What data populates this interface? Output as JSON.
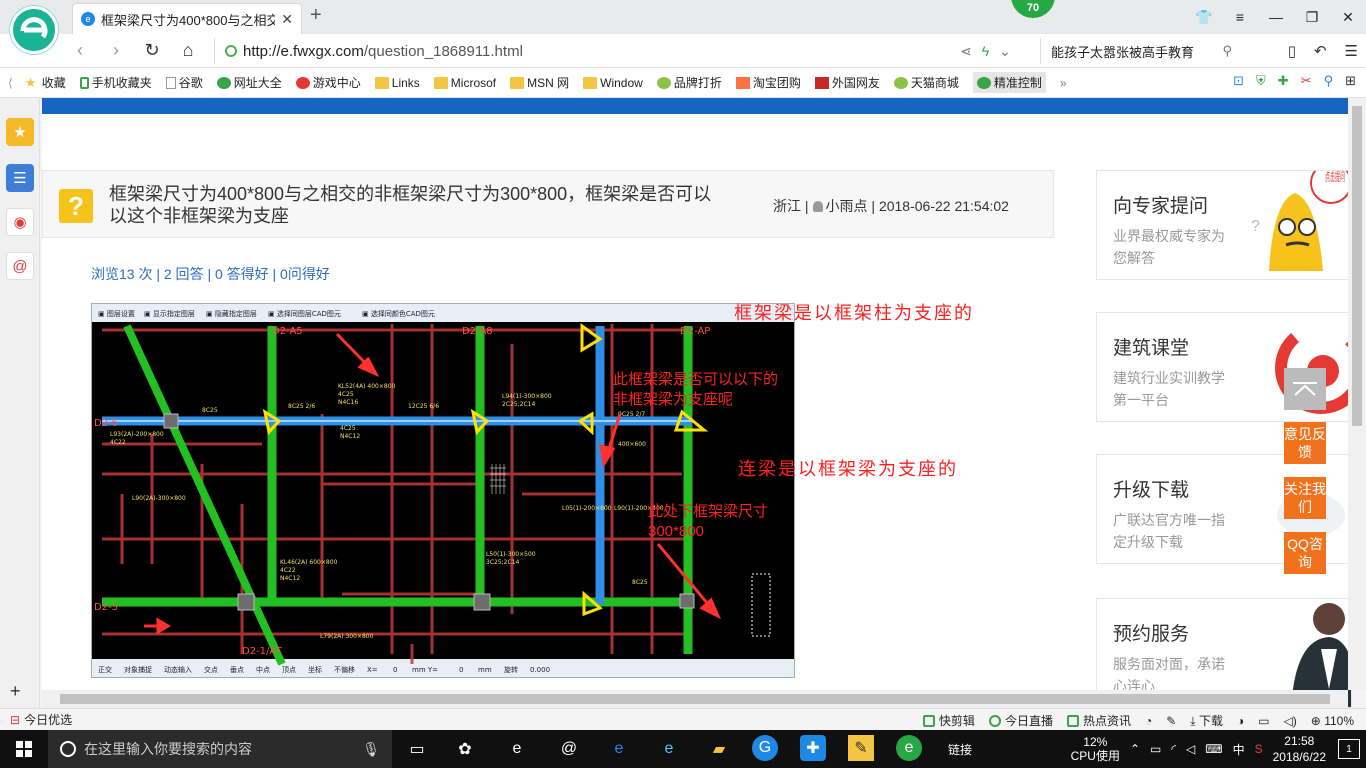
{
  "browser": {
    "tab_title": "框架梁尺寸为400*800与之相交的",
    "tab_badge": "70",
    "url_domain": "http://e.fwxgx.com",
    "url_path": "/question_1868911.html",
    "search_text": "能孩子太嚣张被高手教育"
  },
  "bookmarks": [
    "收藏",
    "手机收藏夹",
    "谷歌",
    "网址大全",
    "游戏中心",
    "Links",
    "Microsof",
    "MSN 网",
    "Window",
    "品牌打折",
    "淘宝团购",
    "外国网友",
    "天猫商城",
    "精准控制"
  ],
  "question": {
    "title": "框架梁尺寸为400*800与之相交的非框架梁尺寸为300*800，框架梁是否可以以这个非框架梁为支座",
    "region": "浙江",
    "user": "小雨点",
    "time": "2018-06-22 21:54:02",
    "stats": "浏览13 次 | 2 回答 | 0 答得好 | 0问得好"
  },
  "annotations": {
    "a1": "框架梁是以框架柱为支座的",
    "a2_line1": "此框架梁是否可以以下的",
    "a2_line2": "非框架梁为支座呢",
    "a3": "连梁是以框架梁为支座的",
    "a4_line1": "此处下框架梁尺寸",
    "a4_line2": "300*800"
  },
  "cad": {
    "toolbar_top": [
      "图层设置",
      "显示指定图层",
      "隐藏指定图层",
      "选择同图层CAD图元",
      "选择同颜色CAD图元"
    ],
    "toolbar_bottom": [
      "正交",
      "对象捕捉",
      "动态输入",
      "交点",
      "垂点",
      "中点",
      "顶点",
      "坐标",
      "不偏移",
      "X=",
      "0",
      "mm Y=",
      "0",
      "mm",
      "旋转",
      "0.000"
    ],
    "axis_labels": [
      "D2-A5",
      "D2-A8",
      "D2-AP",
      "D2-6",
      "D2-3",
      "D2-1/AT"
    ],
    "beam_labels": [
      "KL52(4A) 400×800",
      "4C25",
      "N4C16",
      "L94(1)-300×800",
      "2C25;2C14",
      "L93(2A)-200×800",
      "4C22",
      "KL46(2A) 600×800",
      "4C22",
      "N4C12",
      "L79(2A) 300×800",
      "L50(1)-300×500",
      "3C25;2C14",
      "L90(2A)-300×800",
      "8C25 2/6",
      "12C25 6/6",
      "9C25 2/7",
      "4C25",
      "N4C12",
      "400×600",
      "8C25",
      "L90(1)-200×400",
      "L05(1)-200×800",
      "8C25"
    ]
  },
  "sidebar": {
    "cards": [
      {
        "title": "向专家提问",
        "sub": "业界最权威专家为您解答"
      },
      {
        "title": "建筑课堂",
        "sub": "建筑行业实训教学第一平台"
      },
      {
        "title": "升级下载",
        "sub": "广联达官方唯一指定升级下载"
      },
      {
        "title": "预约服务",
        "sub": "服务面对面，承诺心连心"
      }
    ],
    "corner_promo": "点击提问",
    "float_buttons": [
      "意见反馈",
      "关注我们",
      "QQ咨询"
    ]
  },
  "statusbar": {
    "left": "今日优选",
    "items": [
      "快剪辑",
      "今日直播",
      "热点资讯",
      "下载"
    ],
    "zoom": "110%"
  },
  "taskbar": {
    "search_placeholder": "在这里输入你要搜索的内容",
    "cpu_pct": "12%",
    "cpu_label": "CPU使用",
    "ime": "中",
    "time": "21:58",
    "date": "2018/6/22",
    "notif_count": "1",
    "link_label": "链接"
  },
  "colors": {
    "accent_blue": "#1665c0",
    "orange": "#f2711c",
    "annotation_red": "#ff2020",
    "beam_green": "#22c022",
    "beam_blue": "#2f8ee6"
  }
}
